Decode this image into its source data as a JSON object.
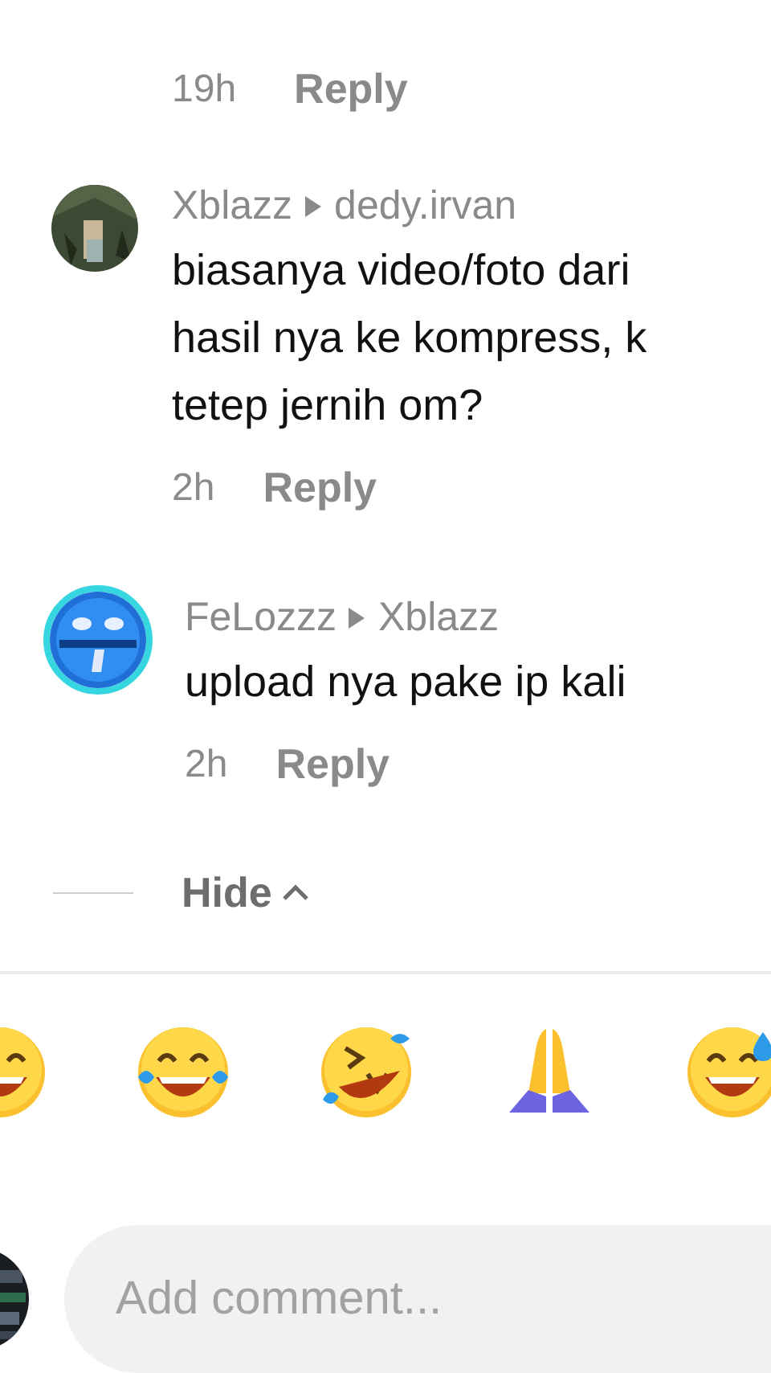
{
  "top_meta": {
    "time": "19h",
    "reply": "Reply"
  },
  "replies": [
    {
      "author": "Xblazz",
      "reply_to": "dedy.irvan",
      "lines": [
        "biasanya video/foto dari",
        "hasil nya ke kompress, k",
        "tetep jernih om?"
      ],
      "time": "2h",
      "reply": "Reply",
      "story_ring": false
    },
    {
      "author": "FeLozzz",
      "reply_to": "Xblazz",
      "lines": [
        "upload nya pake ip kali"
      ],
      "time": "2h",
      "reply": "Reply",
      "story_ring": true
    }
  ],
  "hide": {
    "label": "Hide"
  },
  "composer": {
    "placeholder": "Add comment..."
  }
}
